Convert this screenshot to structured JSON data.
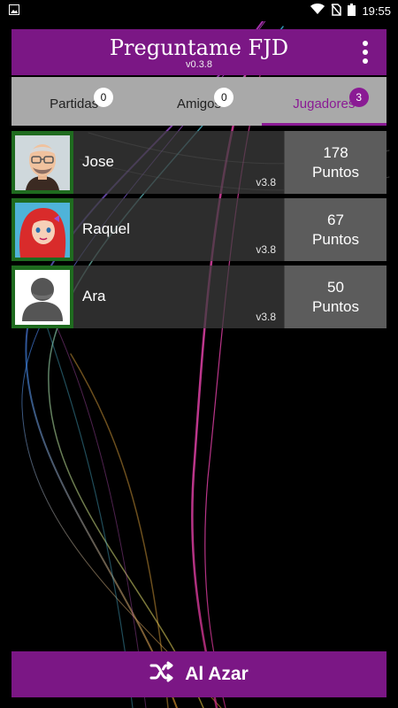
{
  "status_bar": {
    "time": "19:55",
    "icons": [
      "image-notification-icon",
      "wifi-icon",
      "no-sim-icon",
      "battery-icon"
    ]
  },
  "app_bar": {
    "title": "Preguntame FJD",
    "version": "v0.3.8",
    "menu_icon": "more-vert-icon"
  },
  "tabs": [
    {
      "label": "Partidas",
      "count": "0",
      "active": false
    },
    {
      "label": "Amigos",
      "count": "0",
      "active": false
    },
    {
      "label": "Jugadores",
      "count": "3",
      "active": true
    }
  ],
  "players": [
    {
      "name": "Jose",
      "version": "v3.8",
      "points": "178",
      "points_label": "Puntos",
      "avatar": "cartoon-man-avatar"
    },
    {
      "name": "Raquel",
      "version": "v3.8",
      "points": "67",
      "points_label": "Puntos",
      "avatar": "mermaid-avatar"
    },
    {
      "name": "Ara",
      "version": "v3.8",
      "points": "50",
      "points_label": "Puntos",
      "avatar": "default-user-avatar"
    }
  ],
  "random_button": {
    "label": "Al Azar",
    "icon": "shuffle-icon"
  },
  "colors": {
    "primary": "#7b1785",
    "accent": "#8a1a94",
    "tab_bg": "#a9a9a9",
    "avatar_frame": "#1f6b1f",
    "score_bg": "#5c5c5c"
  }
}
